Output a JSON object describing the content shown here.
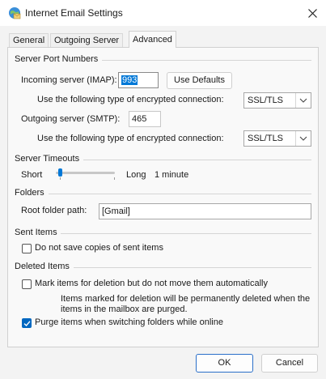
{
  "window": {
    "title": "Internet Email Settings",
    "app_icon": "globe-mail-icon",
    "close_icon": "close-icon"
  },
  "tabs": [
    {
      "label": "General",
      "active": false
    },
    {
      "label": "Outgoing Server",
      "active": false
    },
    {
      "label": "Advanced",
      "active": true
    }
  ],
  "server_ports": {
    "heading": "Server Port Numbers",
    "incoming_label": "Incoming server (IMAP):",
    "incoming_value": "993",
    "use_defaults": "Use Defaults",
    "incoming_encryption_label": "Use the following type of encrypted connection:",
    "incoming_encryption_value": "SSL/TLS",
    "outgoing_label": "Outgoing server (SMTP):",
    "outgoing_value": "465",
    "outgoing_encryption_label": "Use the following type of encrypted connection:",
    "outgoing_encryption_value": "SSL/TLS"
  },
  "timeouts": {
    "heading": "Server Timeouts",
    "short_label": "Short",
    "long_label": "Long",
    "value_text": "1 minute",
    "slider_position": 0.07
  },
  "folders": {
    "heading": "Folders",
    "root_label": "Root folder path:",
    "root_value": "[Gmail]"
  },
  "sent_items": {
    "heading": "Sent Items",
    "do_not_save_label": "Do not save copies of sent items",
    "do_not_save_checked": false
  },
  "deleted_items": {
    "heading": "Deleted Items",
    "mark_label": "Mark items for deletion but do not move them automatically",
    "mark_checked": false,
    "note_line1": "Items marked for deletion will be permanently deleted when the",
    "note_line2": "items in the mailbox are purged.",
    "purge_label": "Purge items when switching folders while online",
    "purge_checked": true
  },
  "footer": {
    "ok": "OK",
    "cancel": "Cancel"
  },
  "colors": {
    "accent": "#0078d7",
    "checkbox_checked": "#0067c0",
    "window_bg": "#f3f3f3"
  }
}
